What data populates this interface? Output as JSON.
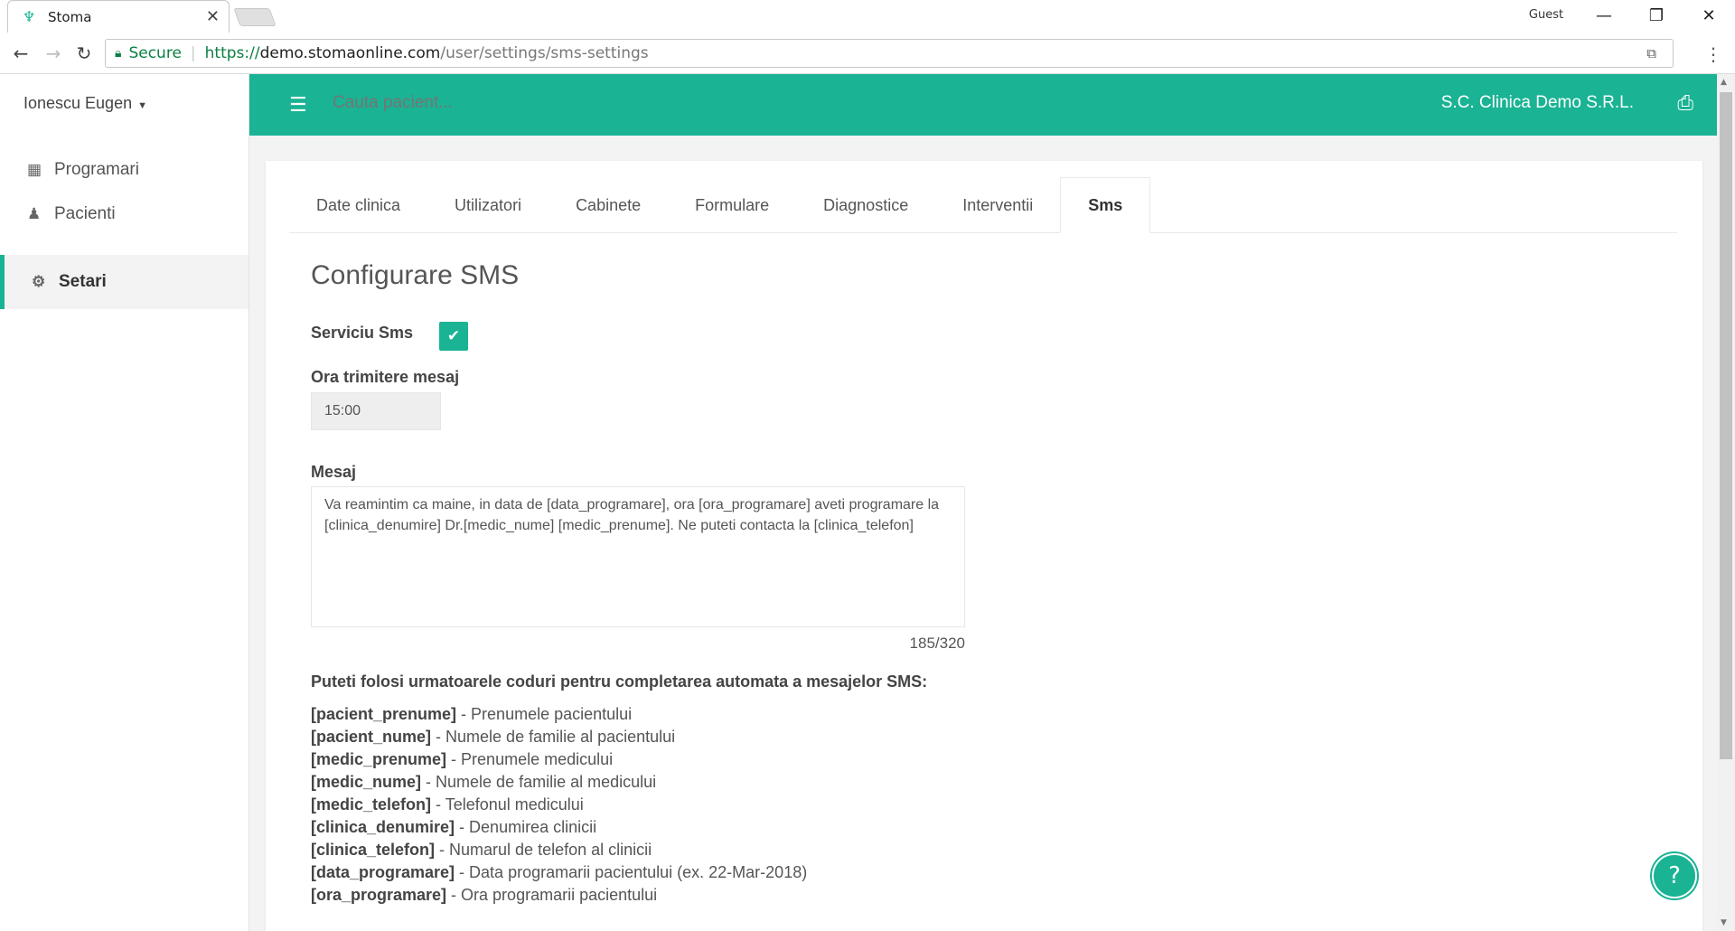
{
  "browser": {
    "tab_title": "Stoma",
    "tab_close": "✕",
    "guest": "Guest",
    "minimize": "—",
    "restore": "❐",
    "close": "✕",
    "secure": "Secure",
    "url_proto": "https://",
    "url_host": "demo.stomaonline.com",
    "url_path": "/user/settings/sms-settings"
  },
  "sidebar": {
    "user": "Ionescu Eugen",
    "items": [
      {
        "label": "Programari",
        "icon": "calendar-icon"
      },
      {
        "label": "Pacienti",
        "icon": "person-icon"
      },
      {
        "label": "Setari",
        "icon": "gear-icon",
        "active": true
      }
    ]
  },
  "topbar": {
    "search_placeholder": "Cauta pacient...",
    "clinic": "S.C. Clinica Demo S.R.L."
  },
  "tabs": [
    "Date clinica",
    "Utilizatori",
    "Cabinete",
    "Formulare",
    "Diagnostice",
    "Interventii",
    "Sms"
  ],
  "form": {
    "title": "Configurare SMS",
    "service_label": "Serviciu Sms",
    "service_checked": true,
    "time_label": "Ora trimitere mesaj",
    "time_value": "15:00",
    "message_label": "Mesaj",
    "message_value": "Va reamintim ca maine, in data de [data_programare], ora [ora_programare] aveti programare la [clinica_denumire] Dr.[medic_nume] [medic_prenume]. Ne puteti contacta la [clinica_telefon]",
    "counter": "185/320",
    "codes_intro": "Puteti folosi urmatoarele coduri pentru completarea automata a mesajelor SMS:",
    "codes": [
      {
        "code": "[pacient_prenume]",
        "desc": " - Prenumele pacientului"
      },
      {
        "code": "[pacient_nume]",
        "desc": " - Numele de familie al pacientului"
      },
      {
        "code": "[medic_prenume]",
        "desc": " - Prenumele medicului"
      },
      {
        "code": "[medic_nume]",
        "desc": " - Numele de familie al medicului"
      },
      {
        "code": "[medic_telefon]",
        "desc": " - Telefonul medicului"
      },
      {
        "code": "[clinica_denumire]",
        "desc": " - Denumirea clinicii"
      },
      {
        "code": "[clinica_telefon]",
        "desc": " - Numarul de telefon al clinicii"
      },
      {
        "code": "[data_programare]",
        "desc": " - Data programarii pacientului (ex. 22-Mar-2018)"
      },
      {
        "code": "[ora_programare]",
        "desc": " - Ora programarii pacientului"
      }
    ]
  },
  "help": "?",
  "colors": {
    "accent": "#1ab394"
  }
}
